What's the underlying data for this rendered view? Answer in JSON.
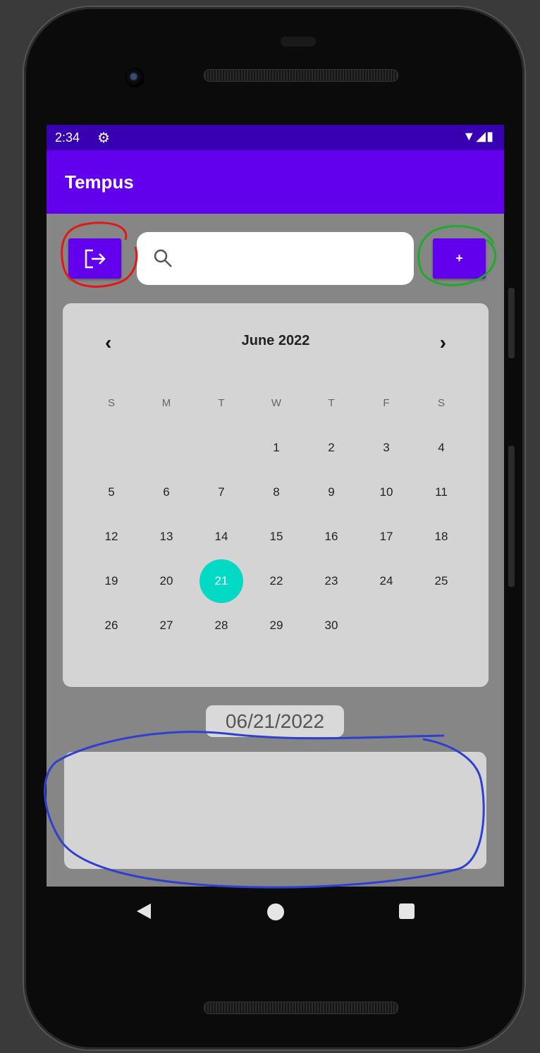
{
  "status_bar": {
    "time": "2:34",
    "settings_icon": "gear-icon",
    "system_icons": "wifi-icon signal-icon battery-icon"
  },
  "app_bar": {
    "title": "Tempus"
  },
  "toolbar": {
    "logout_icon": "logout-icon",
    "add_label": "+"
  },
  "search": {
    "placeholder": "",
    "icon": "search-icon"
  },
  "calendar": {
    "month_label": "June 2022",
    "prev_glyph": "‹",
    "next_glyph": "›",
    "weekdays": [
      "S",
      "M",
      "T",
      "W",
      "T",
      "F",
      "S"
    ],
    "weeks": [
      [
        "",
        "",
        "",
        "1",
        "2",
        "3",
        "4"
      ],
      [
        "5",
        "6",
        "7",
        "8",
        "9",
        "10",
        "11"
      ],
      [
        "12",
        "13",
        "14",
        "15",
        "16",
        "17",
        "18"
      ],
      [
        "19",
        "20",
        "21",
        "22",
        "23",
        "24",
        "25"
      ],
      [
        "26",
        "27",
        "28",
        "29",
        "30",
        "",
        ""
      ]
    ],
    "selected_day": "21",
    "accent_color": "#03dac5"
  },
  "selected_date": "06/21/2022",
  "colors": {
    "primary": "#6200ee",
    "primary_dark": "#3700b3",
    "accent": "#03dac5"
  },
  "nav_bar": {
    "back": "back-icon",
    "home": "home-icon",
    "recent": "recent-apps-icon"
  }
}
